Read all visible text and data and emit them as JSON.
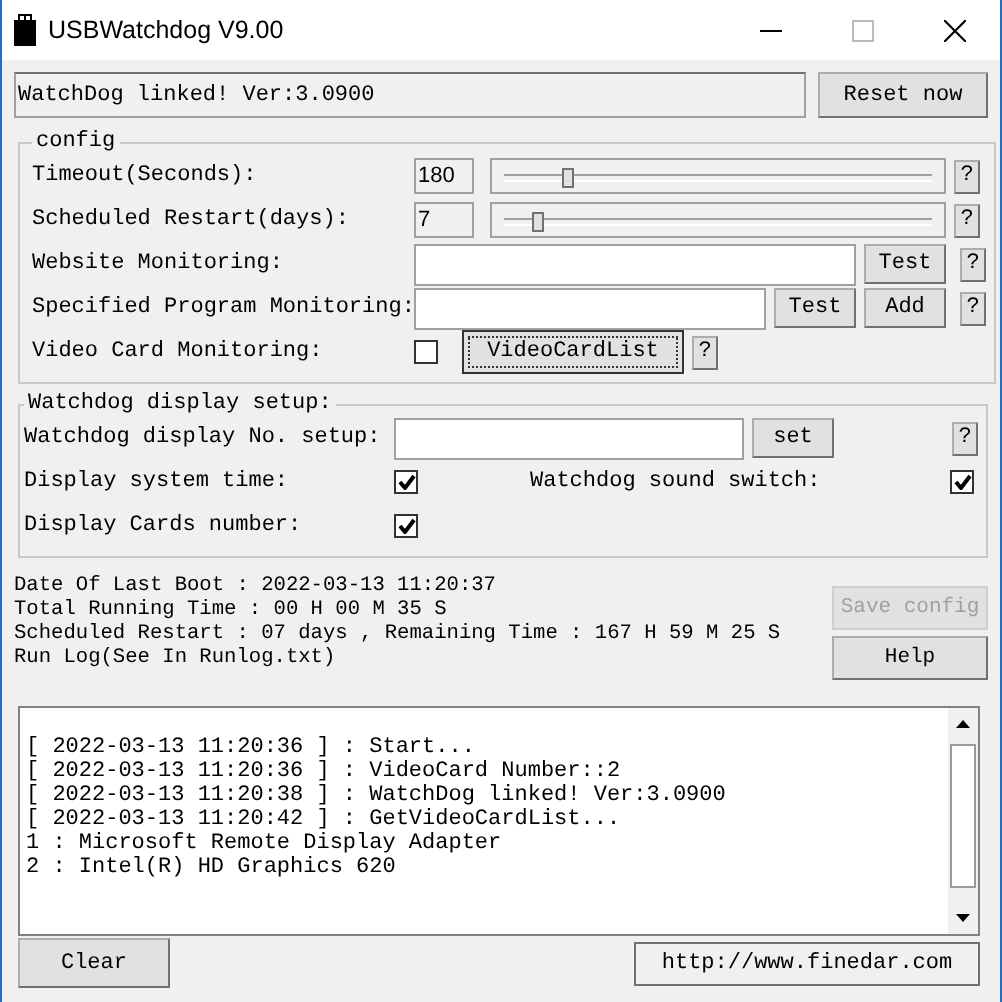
{
  "window": {
    "title": "USBWatchdog V9.00"
  },
  "status": {
    "text": "WatchDog linked! Ver:3.0900"
  },
  "reset_button": "Reset now",
  "config": {
    "title": "config",
    "rows": [
      {
        "kind": "slider",
        "label": "Timeout(Seconds):",
        "value": "180",
        "level": 0.14,
        "help": "?"
      },
      {
        "kind": "slider",
        "label": "Scheduled Restart(days):",
        "value": "7",
        "level": 0.07,
        "help": "?"
      },
      {
        "kind": "text",
        "label": "Website Monitoring:",
        "buttons": [
          "Test"
        ],
        "help": "?"
      },
      {
        "kind": "text",
        "label": "Specified Program Monitoring:",
        "buttons": [
          "Test",
          "Add"
        ],
        "help": "?"
      },
      {
        "kind": "checkbox",
        "label": "Video Card Monitoring:",
        "checked": false,
        "button": "VideoCardList",
        "help": "?"
      }
    ]
  },
  "display_setup": {
    "title": "Watchdog display setup:",
    "no_label": "Watchdog display No. setup:",
    "set_button": "set",
    "help": "?",
    "system_time": {
      "label": "Display system time:",
      "checked": true
    },
    "sound_switch": {
      "label": "Watchdog sound switch:",
      "checked": true
    },
    "cards_number": {
      "label": "Display Cards number:",
      "checked": true
    }
  },
  "info_lines": [
    "Date Of Last Boot : 2022-03-13 11:20:37",
    "Total Running Time : 00 H 00 M 35 S",
    "Scheduled Restart : 07 days , Remaining Time : 167 H 59 M 25 S",
    "Run Log(See In Runlog.txt)"
  ],
  "side_buttons": [
    {
      "label": "Save config",
      "disabled": true
    },
    {
      "label": "Help",
      "disabled": false
    }
  ],
  "log_lines": [
    "[ 2022-03-13 11:20:36 ] : Start...",
    "[ 2022-03-13 11:20:36 ] : VideoCard Number::2",
    "[ 2022-03-13 11:20:38 ] : WatchDog linked! Ver:3.0900",
    "[ 2022-03-13 11:20:42 ] : GetVideoCardList...",
    "1 : Microsoft Remote Display Adapter",
    "2 : Intel(R) HD Graphics 620"
  ],
  "clear_button": "Clear",
  "url_button": "http://www.finedar.com"
}
